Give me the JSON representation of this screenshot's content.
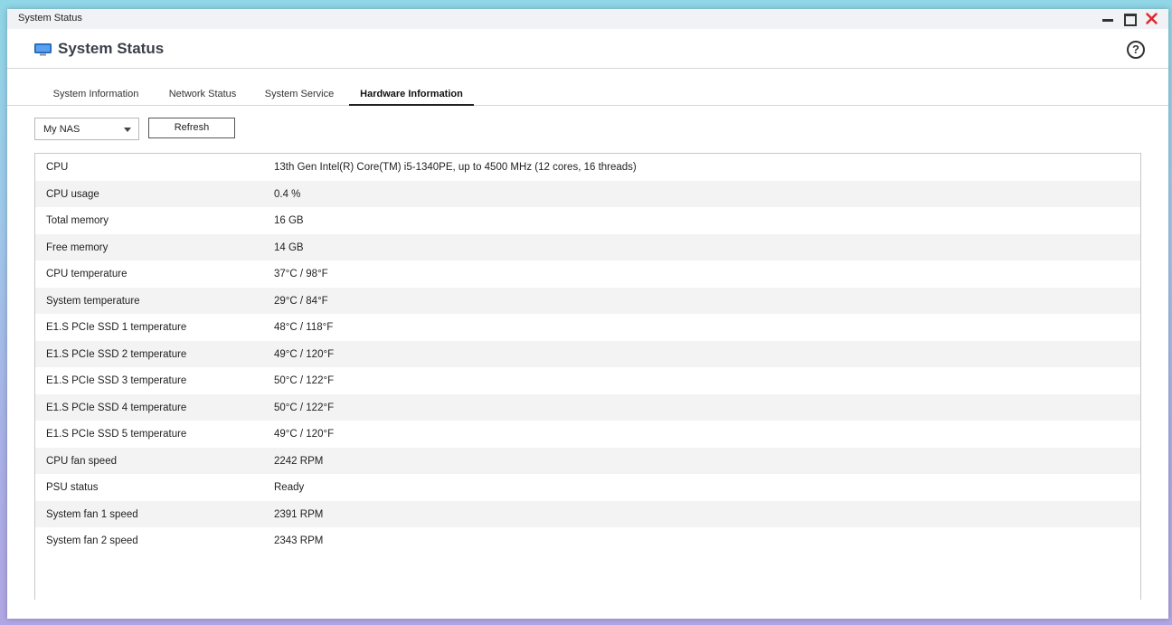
{
  "window": {
    "title": "System Status"
  },
  "app": {
    "title": "System Status",
    "help": "?"
  },
  "tabs": [
    {
      "label": "System Information"
    },
    {
      "label": "Network Status"
    },
    {
      "label": "System Service"
    },
    {
      "label": "Hardware Information"
    }
  ],
  "active_tab": "Hardware Information",
  "toolbar": {
    "device_select": "My NAS",
    "refresh_label": "Refresh"
  },
  "hardware": [
    {
      "key": "CPU",
      "value": "13th Gen Intel(R) Core(TM) i5-1340PE, up to 4500 MHz (12 cores, 16 threads)"
    },
    {
      "key": "CPU usage",
      "value": "0.4 %"
    },
    {
      "key": "Total memory",
      "value": "16 GB"
    },
    {
      "key": "Free memory",
      "value": "14 GB"
    },
    {
      "key": "CPU temperature",
      "value": "37°C / 98°F"
    },
    {
      "key": "System temperature",
      "value": "29°C / 84°F"
    },
    {
      "key": "E1.S PCIe SSD 1 temperature",
      "value": "48°C / 118°F"
    },
    {
      "key": "E1.S PCIe SSD 2 temperature",
      "value": "49°C / 120°F"
    },
    {
      "key": "E1.S PCIe SSD 3 temperature",
      "value": "50°C / 122°F"
    },
    {
      "key": "E1.S PCIe SSD 4 temperature",
      "value": "50°C / 122°F"
    },
    {
      "key": "E1.S PCIe SSD 5 temperature",
      "value": "49°C / 120°F"
    },
    {
      "key": "CPU fan speed",
      "value": "2242 RPM"
    },
    {
      "key": "PSU status",
      "value": "Ready"
    },
    {
      "key": "System fan 1 speed",
      "value": "2391 RPM"
    },
    {
      "key": "System fan 2 speed",
      "value": "2343 RPM"
    }
  ],
  "colors": {
    "accent": "#2e7bd6",
    "close": "#e0262a"
  }
}
